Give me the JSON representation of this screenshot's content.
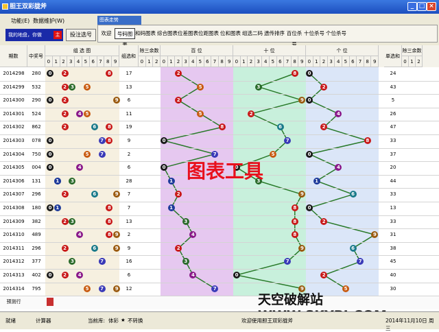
{
  "window": {
    "title": "胆王双彩胧斧"
  },
  "menu": {
    "function": "功能(E)",
    "data_maint": "数据维护(W)"
  },
  "promo": {
    "text": "我的地盘，你做",
    "badge": "主",
    "bet_button": "投注选号"
  },
  "group_label": "图表走势",
  "tabs": [
    "欢迎",
    "号码图表",
    "和码图表",
    "综合图表",
    "位差图表",
    "位距图表",
    "位和图表",
    "组选二码",
    "遗传排序",
    "百位杀号",
    "十位杀号",
    "个位杀号"
  ],
  "active_tab": "号码图表",
  "headers": {
    "period": "期数",
    "prize": "中奖号",
    "group_sel": "组 选 图",
    "group_sum": "组选和",
    "mod3": "除三余数",
    "hundreds": "百 位",
    "tens": "十 位",
    "units": "个 位",
    "single_sum": "单选和",
    "mod3b": "除三余数"
  },
  "digits": [
    "0",
    "1",
    "2",
    "3",
    "4",
    "5",
    "6",
    "7",
    "8",
    "9"
  ],
  "mod_digits": [
    "0",
    "1",
    "2"
  ],
  "rows": [
    {
      "period": "2014298",
      "prize": "280",
      "sum": "17",
      "ssum": "24",
      "h": 2,
      "t": 8,
      "u": 0
    },
    {
      "period": "2014299",
      "prize": "532",
      "sum": "13",
      "ssum": "43",
      "h": 5,
      "t": 3,
      "u": 2
    },
    {
      "period": "2014300",
      "prize": "290",
      "sum": "6",
      "ssum": "5",
      "h": 2,
      "t": 9,
      "u": 0
    },
    {
      "period": "2014301",
      "prize": "524",
      "sum": "11",
      "ssum": "26",
      "h": 5,
      "t": 2,
      "u": 4
    },
    {
      "period": "2014302",
      "prize": "862",
      "sum": "19",
      "ssum": "47",
      "h": 8,
      "t": 6,
      "u": 2
    },
    {
      "period": "2014303",
      "prize": "078",
      "sum": "9",
      "ssum": "33",
      "h": 0,
      "t": 7,
      "u": 8
    },
    {
      "period": "2014304",
      "prize": "750",
      "sum": "2",
      "ssum": "37",
      "h": 7,
      "t": 5,
      "u": 0
    },
    {
      "period": "2014305",
      "prize": "004",
      "sum": "6",
      "ssum": "20",
      "h": 0,
      "t": 0,
      "u": 4
    },
    {
      "period": "2014306",
      "prize": "131",
      "sum": "28",
      "ssum": "44",
      "h": 1,
      "t": 3,
      "u": 1
    },
    {
      "period": "2014307",
      "prize": "296",
      "sum": "7",
      "ssum": "33",
      "h": 2,
      "t": 9,
      "u": 6
    },
    {
      "period": "2014308",
      "prize": "180",
      "sum": "7",
      "ssum": "13",
      "h": 1,
      "t": 8,
      "u": 0
    },
    {
      "period": "2014309",
      "prize": "382",
      "sum": "13",
      "ssum": "33",
      "h": 3,
      "t": 8,
      "u": 2
    },
    {
      "period": "2014310",
      "prize": "489",
      "sum": "2",
      "ssum": "31",
      "h": 4,
      "t": 8,
      "u": 9
    },
    {
      "period": "2014311",
      "prize": "296",
      "sum": "9",
      "ssum": "38",
      "h": 2,
      "t": 9,
      "u": 6
    },
    {
      "period": "2014312",
      "prize": "377",
      "sum": "16",
      "ssum": "45",
      "h": 3,
      "t": 7,
      "u": 7
    },
    {
      "period": "2014313",
      "prize": "402",
      "sum": "6",
      "ssum": "40",
      "h": 4,
      "t": 0,
      "u": 2
    },
    {
      "period": "2014314",
      "prize": "795",
      "sum": "12",
      "ssum": "30",
      "h": 7,
      "t": 9,
      "u": 5
    }
  ],
  "forecast_label": "预测行",
  "overlay_text": "图表工具",
  "watermark": "天空破解站 WWW.SKYPJ.COM",
  "status": {
    "ready": "就绪",
    "calculator": "计算器",
    "db_label": "当前库:",
    "db_value": "体彩",
    "star": "★",
    "convert": "不转换",
    "welcome": "欢迎使用胆王双彩胧斧",
    "date": "2014年11月10日 周三"
  },
  "colors": {
    "hundreds_band": "#e6c8f0",
    "tens_band": "#c8f0dc",
    "units_band": "#dbe6f8",
    "line": "#2a7a2a"
  }
}
